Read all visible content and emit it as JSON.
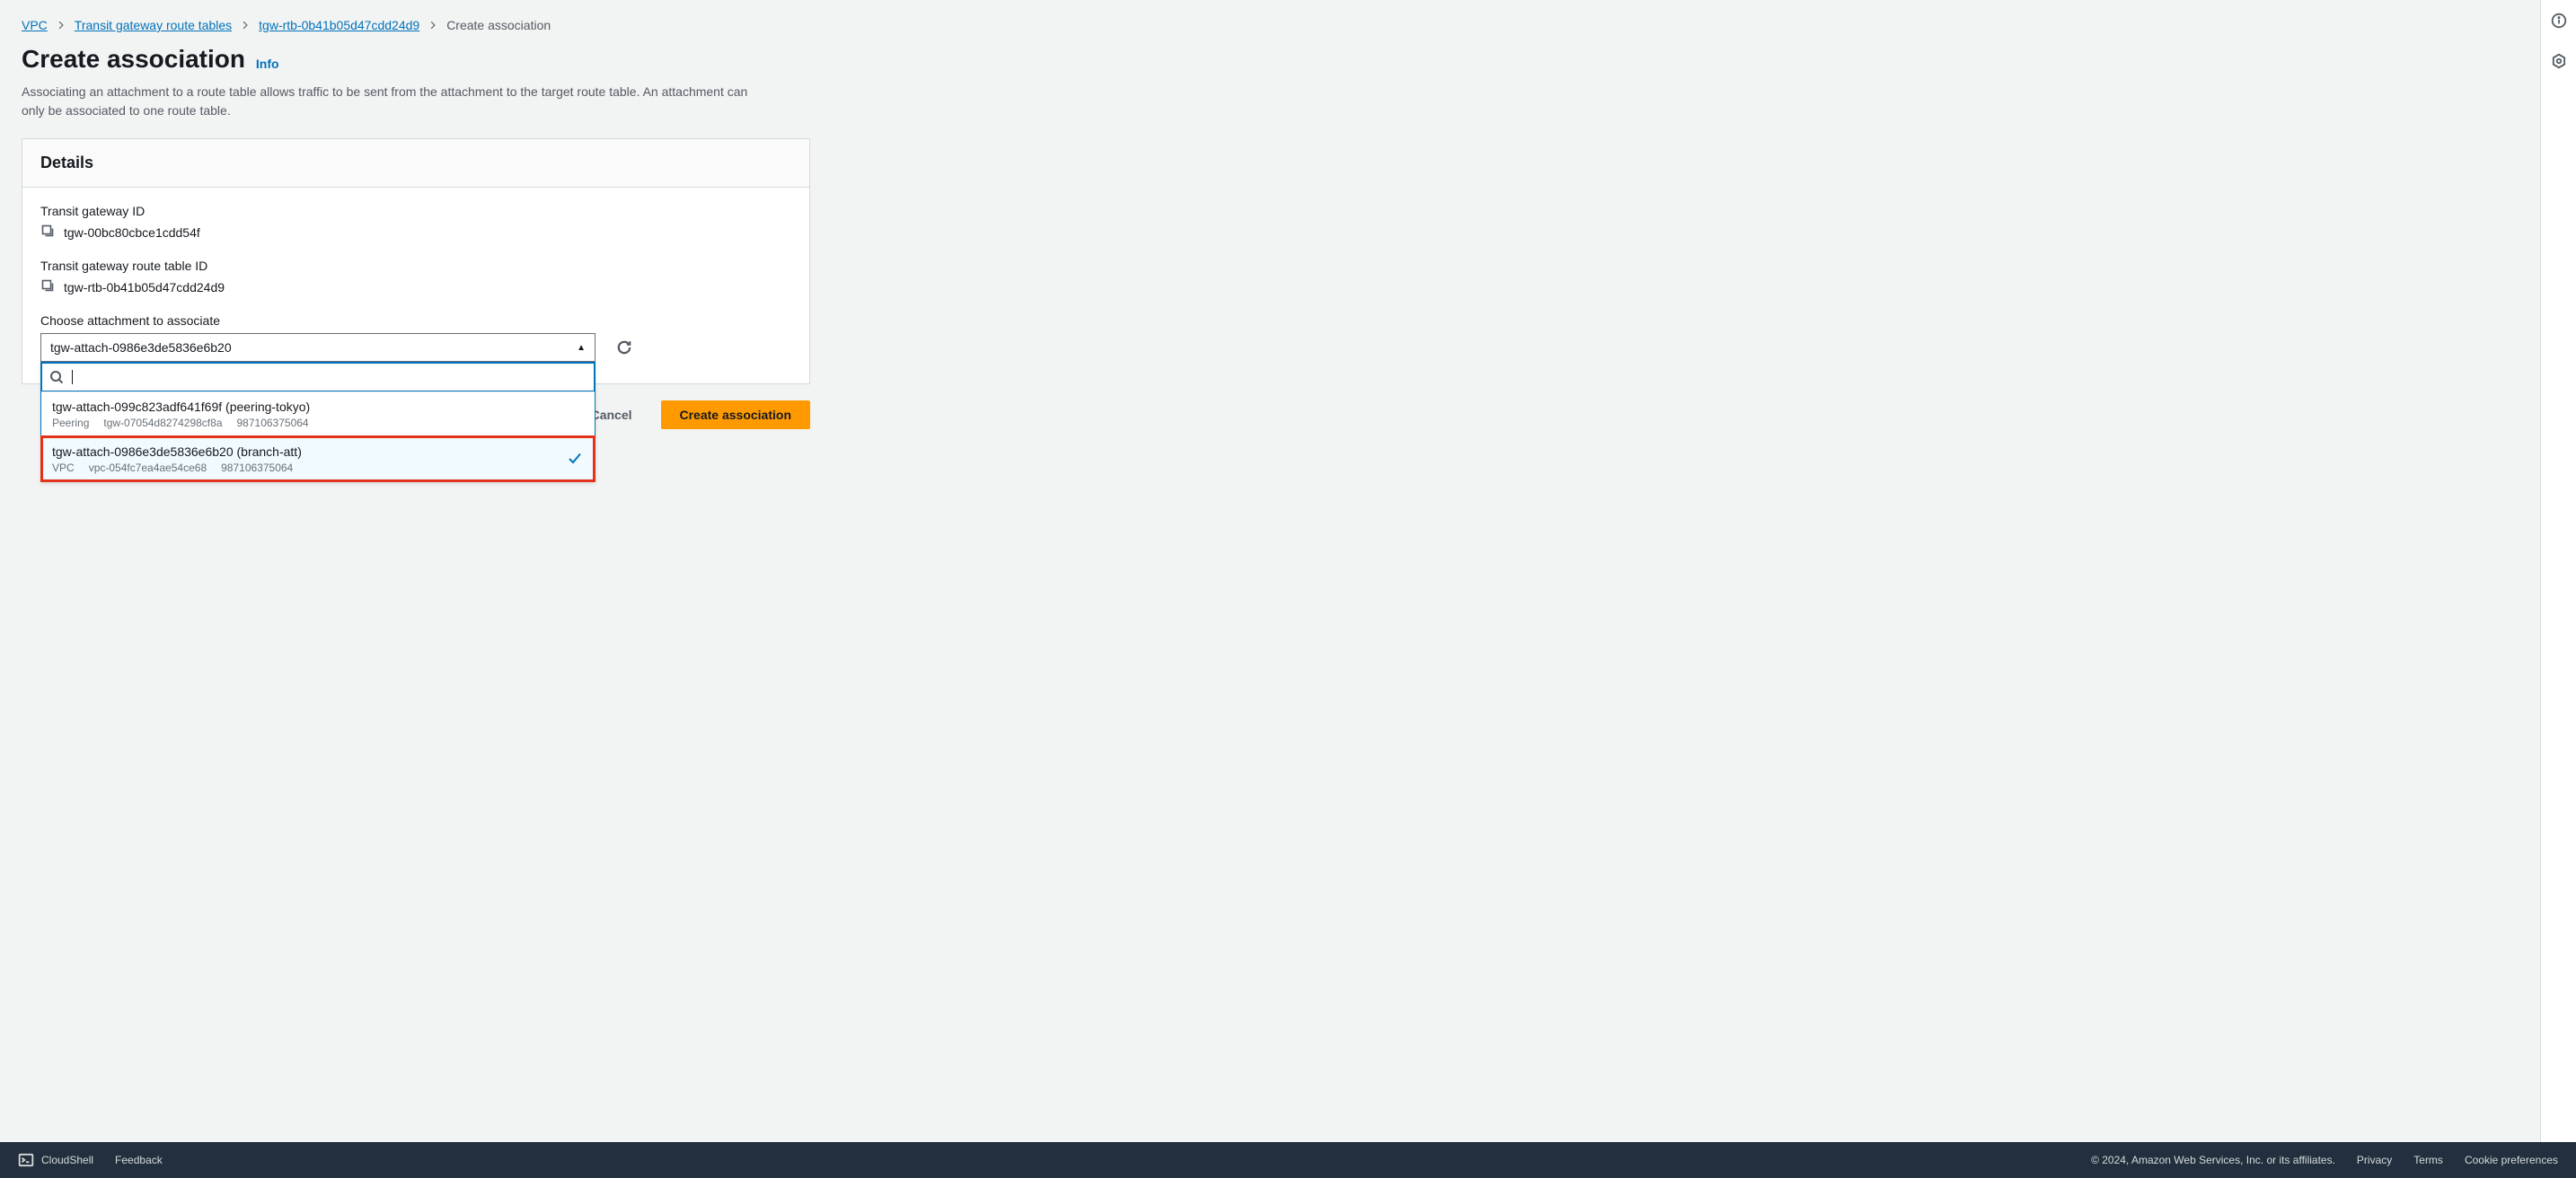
{
  "breadcrumbs": {
    "vpc": "VPC",
    "tables": "Transit gateway route tables",
    "rtb": "tgw-rtb-0b41b05d47cdd24d9",
    "current": "Create association"
  },
  "header": {
    "title": "Create association",
    "info": "Info",
    "description": "Associating an attachment to a route table allows traffic to be sent from the attachment to the target route table. An attachment can only be associated to one route table."
  },
  "panel": {
    "title": "Details",
    "tgw_label": "Transit gateway ID",
    "tgw_value": "tgw-00bc80cbce1cdd54f",
    "rtb_label": "Transit gateway route table ID",
    "rtb_value": "tgw-rtb-0b41b05d47cdd24d9",
    "attach_label": "Choose attachment to associate",
    "selected_value": "tgw-attach-0986e3de5836e6b20"
  },
  "dropdown": {
    "search_placeholder": "",
    "options": [
      {
        "title": "tgw-attach-099c823adf641f69f (peering-tokyo)",
        "type": "Peering",
        "resource": "tgw-07054d8274298cf8a",
        "account": "987106375064",
        "selected": false
      },
      {
        "title": "tgw-attach-0986e3de5836e6b20 (branch-att)",
        "type": "VPC",
        "resource": "vpc-054fc7ea4ae54ce68",
        "account": "987106375064",
        "selected": true
      }
    ]
  },
  "actions": {
    "cancel": "Cancel",
    "submit": "Create association"
  },
  "footer": {
    "cloudshell": "CloudShell",
    "feedback": "Feedback",
    "copyright": "© 2024, Amazon Web Services, Inc. or its affiliates.",
    "privacy": "Privacy",
    "terms": "Terms",
    "cookies": "Cookie preferences"
  }
}
